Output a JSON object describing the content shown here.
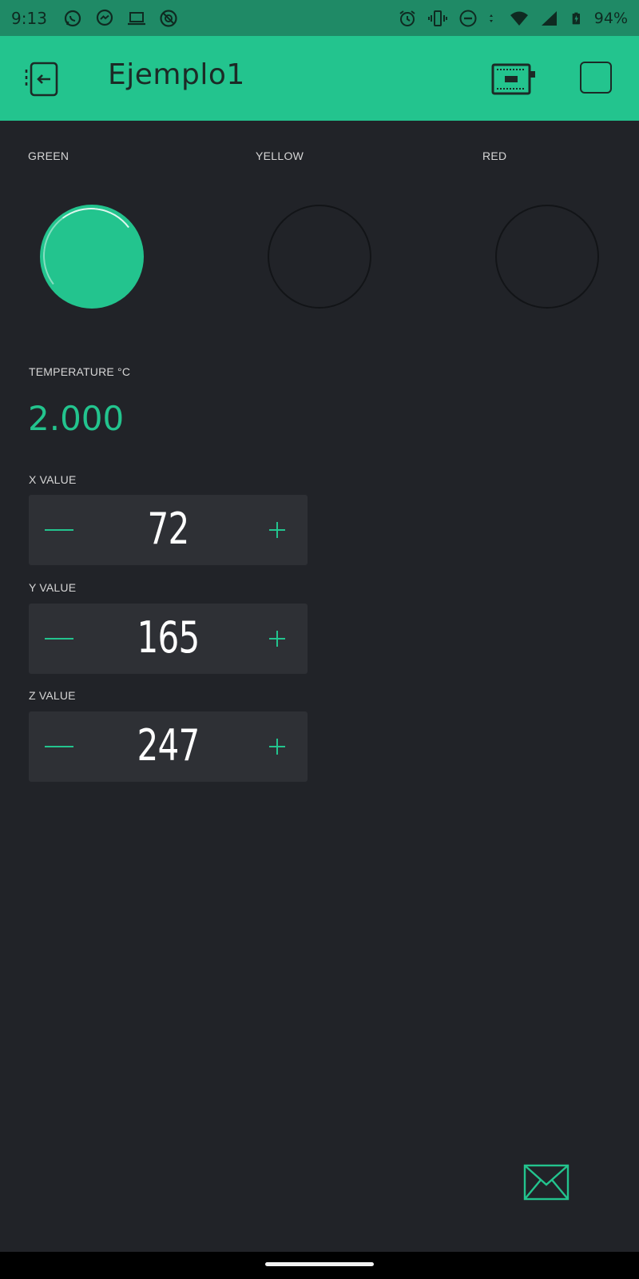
{
  "status_bar": {
    "time": "9:13",
    "left_icons": [
      "whatsapp-icon",
      "messenger-icon",
      "laptop-icon",
      "no-location-icon"
    ],
    "right_icons": [
      "alarm-icon",
      "vibrate-icon",
      "do-not-disturb-icon",
      "data-arrows-icon",
      "wifi-icon",
      "signal-icon",
      "battery-charging-icon"
    ],
    "battery": "94%"
  },
  "app_bar": {
    "title": "Ejemplo1",
    "background": "#23c48e",
    "icons": {
      "exit": "exit-icon",
      "device": "device-board-icon",
      "play": "stop-square-icon"
    }
  },
  "leds": [
    {
      "label": "GREEN",
      "state": "on",
      "color": "#23c48e"
    },
    {
      "label": "YELLOW",
      "state": "off"
    },
    {
      "label": "RED",
      "state": "off"
    }
  ],
  "temperature": {
    "label": "TEMPERATURE °C",
    "value": "2.000",
    "color": "#23c48e"
  },
  "steppers": [
    {
      "label": "X VALUE",
      "value": "72"
    },
    {
      "label": "Y VALUE",
      "value": "165"
    },
    {
      "label": "Z VALUE",
      "value": "247"
    }
  ],
  "accent_color": "#23c48e",
  "background_color": "#212328",
  "email_icon": "envelope-icon"
}
